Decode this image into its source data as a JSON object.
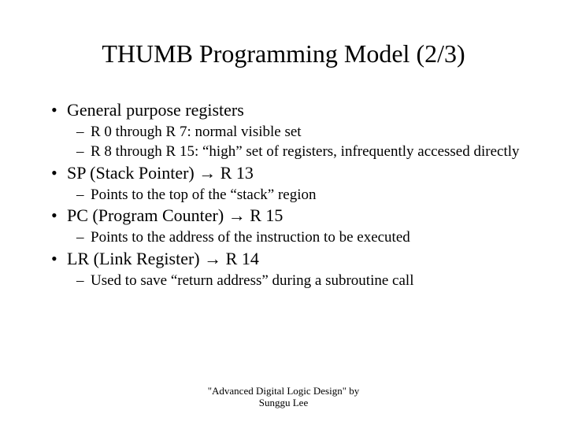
{
  "title": "THUMB Programming Model (2/3)",
  "items": [
    {
      "text": "General purpose registers",
      "sub": [
        "R 0 through R 7: normal visible set",
        "R 8 through R 15: “high” set of registers, infrequently accessed directly"
      ]
    },
    {
      "text": "SP (Stack Pointer) → R 13",
      "sub": [
        "Points to the top of the “stack” region"
      ]
    },
    {
      "text": "PC (Program Counter) → R 15",
      "sub": [
        "Points to the address of the instruction to be executed"
      ]
    },
    {
      "text": "LR (Link Register) → R 14",
      "sub": [
        "Used to save “return address” during a subroutine call"
      ]
    }
  ],
  "footer_line1": "\"Advanced Digital Logic Design\" by",
  "footer_line2": "Sunggu Lee"
}
